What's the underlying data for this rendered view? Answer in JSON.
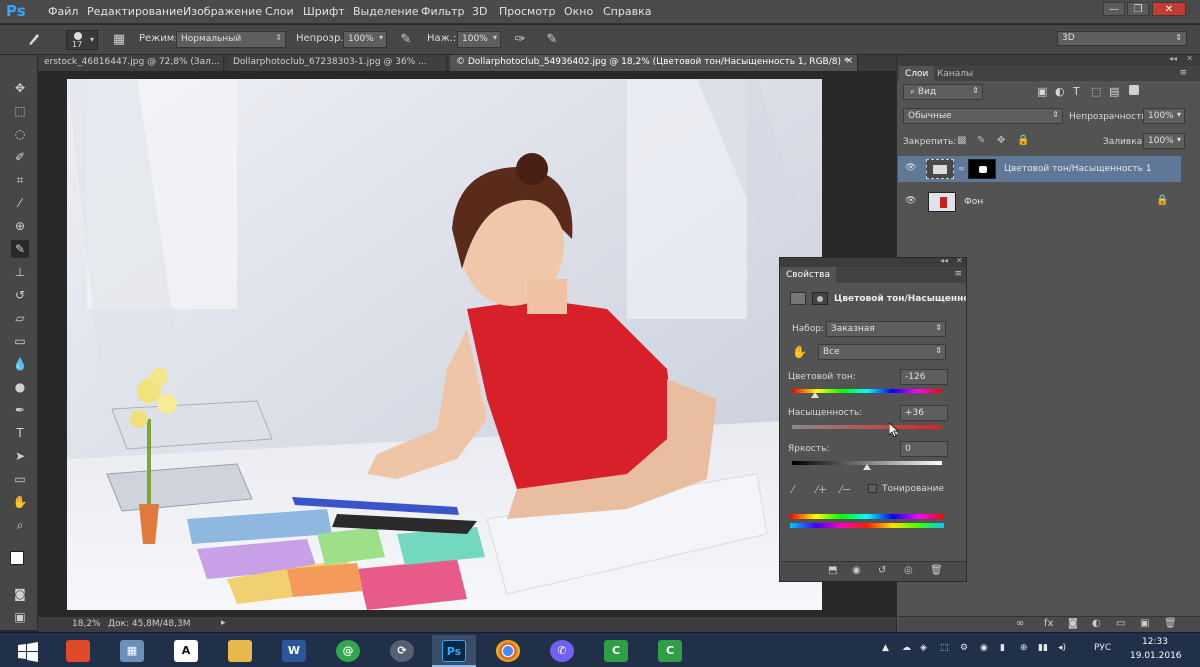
{
  "menubar": {
    "logo": "Ps",
    "items": [
      "Файл",
      "Редактирование",
      "Изображение",
      "Слои",
      "Шрифт",
      "Выделение",
      "Фильтр",
      "3D",
      "Просмотр",
      "Окно",
      "Справка"
    ],
    "win_min": "—",
    "win_max": "❐",
    "win_close": "✕"
  },
  "options": {
    "brush_size": "17",
    "mode_label": "Режим:",
    "mode_value": "Нормальный",
    "opacity_label": "Непрозр.:",
    "opacity_value": "100%",
    "pressure_label": "Наж.:",
    "pressure_value": "100%",
    "workspace_value": "3D"
  },
  "tabs": [
    "erstock_46816447.jpg @ 72,8% (Зал...",
    "Dollarphotoclub_67238303-1.jpg @ 36% ...",
    "© Dollarphotoclub_54936402.jpg @ 18,2% (Цветовой тон/Насыщенность 1, RGB/8) *"
  ],
  "tab_close": "×",
  "status": {
    "zoom": "18,2%",
    "doc": "Док: 45,8M/48,3M"
  },
  "layers_panel": {
    "tab_layers": "Слои",
    "tab_channels": "Каналы",
    "filter_value": "Вид",
    "blend_value": "Обычные",
    "opacity_label": "Непрозрачность:",
    "opacity_value": "100%",
    "lock_label": "Закрепить:",
    "fill_label": "Заливка:",
    "fill_value": "100%",
    "layers": [
      {
        "name": "Цветовой тон/Насыщенность 1",
        "selected": true
      },
      {
        "name": "Фон",
        "selected": false
      }
    ]
  },
  "properties": {
    "tab": "Свойства",
    "title": "Цветовой тон/Насыщенность",
    "preset_label": "Набор:",
    "preset_value": "Заказная",
    "channel_value": "Все",
    "hue_label": "Цветовой тон:",
    "hue_value": "-126",
    "saturation_label": "Насыщенность:",
    "saturation_value": "+36",
    "lightness_label": "Яркость:",
    "lightness_value": "0",
    "colorize_label": "Тонирование",
    "hue_fraction": 0.15,
    "saturation_fraction": 0.68,
    "lightness_fraction": 0.5
  },
  "taskbar": {
    "apps": [
      {
        "name": "windows-start",
        "label": "",
        "color": "#203048"
      },
      {
        "name": "app-mosaic",
        "label": "",
        "color": "#e04a2a"
      },
      {
        "name": "app-calculator",
        "label": "",
        "color": "#6d8fb8"
      },
      {
        "name": "app-font",
        "label": "A",
        "color": "#2a2a2a"
      },
      {
        "name": "app-explorer",
        "label": "",
        "color": "#e8b84a"
      },
      {
        "name": "app-word",
        "label": "W",
        "color": "#2b579a"
      },
      {
        "name": "app-mail-agent",
        "label": "@",
        "color": "#2fa84f"
      },
      {
        "name": "app-network",
        "label": "",
        "color": "#556070"
      },
      {
        "name": "app-photoshop",
        "label": "Ps",
        "color": "#0a2744"
      },
      {
        "name": "app-chrome",
        "label": "",
        "color": "#dd4b39"
      },
      {
        "name": "app-viber",
        "label": "",
        "color": "#7360f2"
      },
      {
        "name": "app-camtasia-1",
        "label": "C",
        "color": "#2f9e44"
      },
      {
        "name": "app-camtasia-2",
        "label": "C",
        "color": "#2f9e44"
      }
    ],
    "lang": "РУС",
    "time": "12:33",
    "date": "19.01.2016"
  }
}
